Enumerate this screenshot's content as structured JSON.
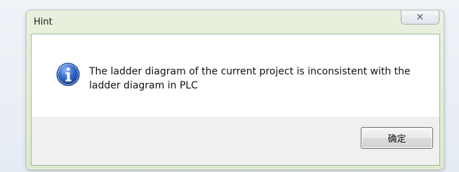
{
  "dialog": {
    "title": "Hint",
    "close_glyph": "✕",
    "message": "The ladder diagram of the current project is inconsistent with the ladder diagram in PLC",
    "icon": "info-icon",
    "ok_label": "确定"
  },
  "colors": {
    "frame": "#e1ecd4",
    "icon_blue": "#2f66c8"
  }
}
